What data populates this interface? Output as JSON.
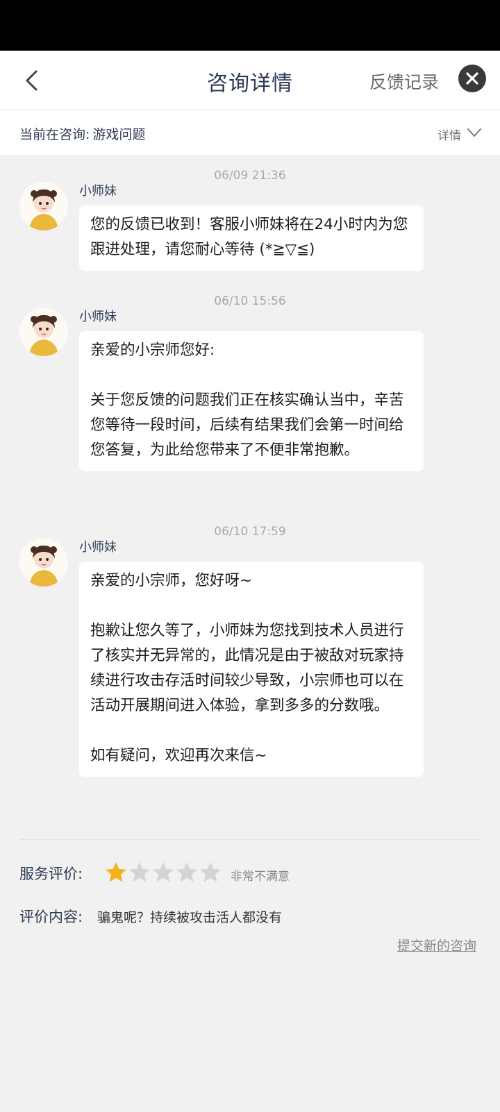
{
  "header": {
    "title": "咨询详情",
    "feedback_record": "反馈记录",
    "back_icon": "chevron-left-icon",
    "close_icon": "close-icon"
  },
  "topic": {
    "label": "当前在咨询:",
    "value": "游戏问题",
    "detail": "详情"
  },
  "messages": [
    {
      "time": "06/09 21:36",
      "sender": "小师妹",
      "text": "您的反馈已收到！客服小师妹将在24小时内为您跟进处理，请您耐心等待 (*≧▽≦)"
    },
    {
      "time": "06/10 15:56",
      "sender": "小师妹",
      "text": "亲爱的小宗师您好:\n\n关于您反馈的问题我们正在核实确认当中，辛苦您等待一段时间，后续有结果我们会第一时间给您答复，为此给您带来了不便非常抱歉。"
    },
    {
      "time": "06/10 17:59",
      "sender": "小师妹",
      "text": "亲爱的小宗师，您好呀~\n\n抱歉让您久等了，小师妹为您找到技术人员进行了核实并无异常的，此情况是由于被敌对玩家持续进行攻击存活时间较少导致，小宗师也可以在活动开展期间进入体验，拿到多多的分数哦。\n\n如有疑问，欢迎再次来信~"
    }
  ],
  "rating": {
    "label": "服务评价:",
    "stars_filled": 1,
    "stars_total": 5,
    "text": "非常不满意",
    "filled_color": "#f6b21b",
    "empty_color": "#d4d4d4"
  },
  "comment": {
    "label": "评价内容:",
    "text": "骗鬼呢？持续被攻击活人都没有"
  },
  "new_consult": "提交新的咨询"
}
